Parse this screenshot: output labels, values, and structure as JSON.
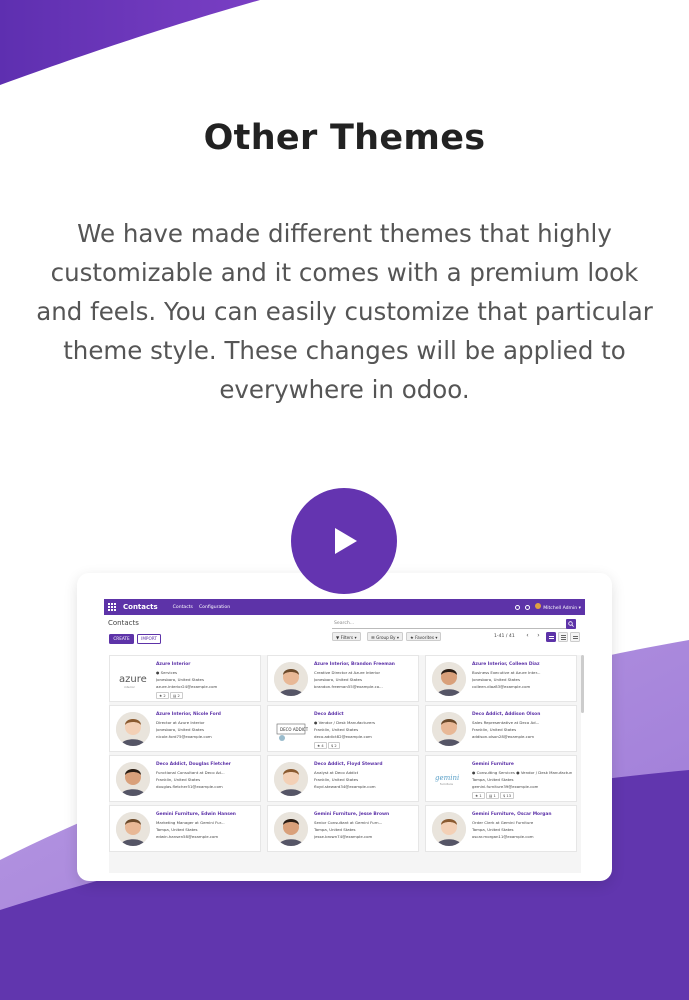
{
  "heading": "Other Themes",
  "description": "We have made different themes that highly customizable and it comes with a premium look and feels. You can easily customize that particular theme style. These changes will be applied to everywhere in odoo.",
  "colors": {
    "accent": "#6434b0",
    "bar": "#5d33a8",
    "text": "#222222",
    "body_text": "#555555"
  },
  "play_icon": "play-icon",
  "screenshot": {
    "brand": "Contacts",
    "menu": [
      "Contacts",
      "Configuration"
    ],
    "user": "Mitchell Admin",
    "breadcrumb": "Contacts",
    "search_placeholder": "Search...",
    "create_label": "CREATE",
    "import_label": "IMPORT",
    "filters_label": "Filters",
    "groupby_label": "Group By",
    "favorites_label": "Favorites",
    "pager": "1-41 / 41",
    "cards": [
      {
        "name": "Azure Interior",
        "lines": [
          "● Services",
          "Jonesboro, United States",
          "azure.interior24@example.com"
        ],
        "badges": [
          "★ 2",
          "▤ 2"
        ],
        "logo": "azure"
      },
      {
        "name": "Azure Interior, Brandon Freeman",
        "lines": [
          "Creative Director at Azure Interior",
          "Jonesboro, United States",
          "brandon.freeman55@example.co..."
        ],
        "badges": []
      },
      {
        "name": "Azure Interior, Colleen Diaz",
        "lines": [
          "Business Executive at Azure Inter...",
          "Jonesboro, United States",
          "colleen.diaz83@example.com"
        ],
        "badges": []
      },
      {
        "name": "Azure Interior, Nicole Ford",
        "lines": [
          "Director at Azure Interior",
          "Jonesboro, United States",
          "nicole.ford75@example.com"
        ],
        "badges": []
      },
      {
        "name": "Deco Addict",
        "lines": [
          "● Vendor / Desk Manufacturers",
          "Franklin, United States",
          "deco.addict82@example.com"
        ],
        "badges": [
          "★ 4",
          "$ 2"
        ],
        "logo": "deco"
      },
      {
        "name": "Deco Addict, Addison Olson",
        "lines": [
          "Sales Representative at Deco Ad...",
          "Franklin, United States",
          "addison.olson28@example.com"
        ],
        "badges": []
      },
      {
        "name": "Deco Addict, Douglas Fletcher",
        "lines": [
          "Functional Consultant at Deco Ad...",
          "Franklin, United States",
          "douglas.fletcher51@example.com"
        ],
        "badges": []
      },
      {
        "name": "Deco Addict, Floyd Steward",
        "lines": [
          "Analyst at Deco Addict",
          "Franklin, United States",
          "floyd.steward34@example.com"
        ],
        "badges": []
      },
      {
        "name": "Gemini Furniture",
        "lines": [
          "● Consulting Services ● Vendor / Desk Manufacturers",
          "Tampa, United States",
          "gemini.furniture39@example.com"
        ],
        "badges": [
          "★ 1",
          "▤ 1",
          "$ 13"
        ],
        "logo": "gemini"
      },
      {
        "name": "Gemini Furniture, Edwin Hansen",
        "lines": [
          "Marketing Manager at Gemini Fur...",
          "Tampa, United States",
          "edwin.hansen58@example.com"
        ],
        "badges": []
      },
      {
        "name": "Gemini Furniture, Jesse Brown",
        "lines": [
          "Senior Consultant at Gemini Furn...",
          "Tampa, United States",
          "jesse.brown74@example.com"
        ],
        "badges": []
      },
      {
        "name": "Gemini Furniture, Oscar Morgan",
        "lines": [
          "Order Clerk at Gemini Furniture",
          "Tampa, United States",
          "oscar.morgan11@example.com"
        ],
        "badges": []
      }
    ]
  }
}
